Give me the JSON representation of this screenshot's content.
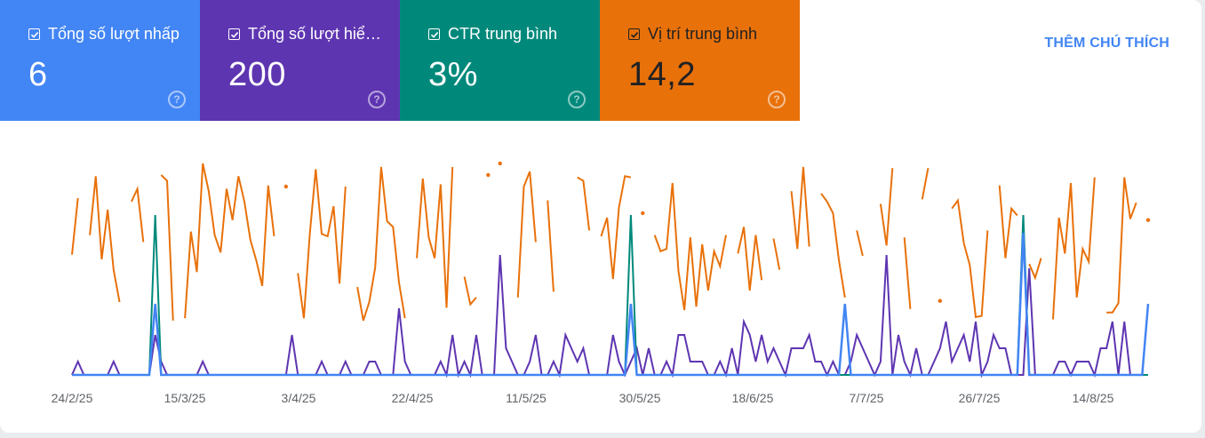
{
  "metrics": [
    {
      "label": "Tổng số lượt nhấp",
      "value": "6",
      "color": "#4285f4",
      "text_color": "#ffffff"
    },
    {
      "label": "Tổng số lượt hiể…",
      "value": "200",
      "color": "#5e35b1",
      "text_color": "#ffffff"
    },
    {
      "label": "CTR trung bình",
      "value": "3%",
      "color": "#00897b",
      "text_color": "#ffffff"
    },
    {
      "label": "Vị trí trung bình",
      "value": "14,2",
      "color": "#e8710a",
      "text_color": "#202124"
    }
  ],
  "annotation_button": "THÊM CHÚ THÍCH",
  "help_glyph": "?",
  "chart_data": {
    "type": "line",
    "x_ticks": [
      "24/2/25",
      "15/3/25",
      "3/4/25",
      "22/4/25",
      "11/5/25",
      "30/5/25",
      "18/6/25",
      "7/7/25",
      "26/7/25",
      "14/8/25"
    ],
    "days": 182,
    "start_date": "2025-02-21",
    "grid": false,
    "series": [
      {
        "color": "#5e35b1",
        "values": [
          0,
          1,
          0,
          0,
          0,
          0,
          0,
          1,
          0,
          0,
          0,
          0,
          0,
          0,
          3,
          1,
          0,
          0,
          0,
          0,
          0,
          0,
          1,
          0,
          0,
          0,
          0,
          0,
          0,
          0,
          0,
          0,
          0,
          0,
          0,
          0,
          0,
          3,
          0,
          0,
          0,
          0,
          1,
          0,
          0,
          0,
          1,
          0,
          0,
          0,
          1,
          1,
          0,
          0,
          0,
          5,
          1,
          0,
          0,
          0,
          0,
          0,
          1,
          0,
          3,
          0,
          1,
          0,
          3,
          0,
          0,
          0,
          9,
          2,
          1,
          0,
          0,
          1,
          3,
          0,
          0,
          1,
          0,
          3,
          2,
          1,
          2,
          0,
          0,
          0,
          0,
          3,
          1,
          0,
          1,
          2,
          0,
          2,
          0,
          0,
          1,
          0,
          3,
          3,
          1,
          1,
          1,
          0,
          0,
          1,
          0,
          2,
          0,
          4,
          3,
          1,
          3,
          1,
          2,
          1,
          0,
          2,
          2,
          2,
          3,
          1,
          1,
          0,
          1,
          0,
          0,
          1,
          3,
          2,
          1,
          0,
          1,
          9,
          0,
          3,
          1,
          0,
          2,
          0,
          0,
          1,
          2,
          4,
          1,
          2,
          3,
          1,
          4,
          0,
          1,
          3,
          2,
          2,
          0,
          0,
          0,
          8,
          0,
          0,
          0,
          0,
          1,
          1,
          0,
          1,
          1,
          1,
          0,
          2,
          2,
          4,
          0,
          4,
          0,
          0,
          0,
          0,
          0,
          0,
          1,
          1,
          1,
          1
        ]
      },
      {
        "color": "#00897b",
        "values": [
          0,
          0,
          0,
          0,
          0,
          0,
          0,
          0,
          0,
          0,
          0,
          0,
          0,
          0,
          1,
          0,
          0,
          0,
          0,
          0,
          0,
          0,
          0,
          0,
          0,
          0,
          0,
          0,
          0,
          0,
          0,
          0,
          0,
          0,
          0,
          0,
          0,
          0,
          0,
          0,
          0,
          0,
          0,
          0,
          0,
          0,
          0,
          0,
          0,
          0,
          0,
          0,
          0,
          0,
          0,
          0,
          0,
          0,
          0,
          0,
          0,
          0,
          0,
          0,
          0,
          0,
          0,
          0,
          0,
          0,
          0,
          0,
          0,
          0,
          0,
          0,
          0,
          0,
          0,
          0,
          0,
          0,
          0,
          0,
          0,
          0,
          0,
          0,
          0,
          0,
          0,
          0,
          0,
          0,
          1,
          0,
          0,
          0,
          0,
          0,
          0,
          0,
          0,
          0,
          0,
          0,
          0,
          0,
          0,
          0,
          0,
          0,
          0,
          0,
          0,
          0,
          0,
          0,
          0,
          0,
          0,
          0,
          0,
          0,
          0,
          0,
          0,
          0,
          0,
          0,
          0,
          0,
          0,
          0,
          0,
          0,
          0,
          0,
          0,
          0,
          0,
          0,
          0,
          0,
          0,
          0,
          0,
          0,
          0,
          0,
          0,
          0,
          0,
          0,
          0,
          0,
          0,
          0,
          0,
          0,
          1,
          0,
          0,
          0,
          0,
          0,
          0,
          0,
          0,
          0,
          0,
          0,
          0,
          0,
          0,
          0,
          0,
          0,
          0,
          0,
          0,
          0,
          0,
          0,
          0,
          0,
          0,
          0,
          0,
          0,
          0,
          0
        ]
      },
      {
        "color": "#4285f4",
        "values": [
          0,
          0,
          0,
          0,
          0,
          0,
          0,
          0,
          0,
          0,
          0,
          0,
          0,
          0,
          1,
          0,
          0,
          0,
          0,
          0,
          0,
          0,
          0,
          0,
          0,
          0,
          0,
          0,
          0,
          0,
          0,
          0,
          0,
          0,
          0,
          0,
          0,
          0,
          0,
          0,
          0,
          0,
          0,
          0,
          0,
          0,
          0,
          0,
          0,
          0,
          0,
          0,
          0,
          0,
          0,
          0,
          0,
          0,
          0,
          0,
          0,
          0,
          0,
          0,
          0,
          0,
          0,
          0,
          0,
          0,
          0,
          0,
          0,
          0,
          0,
          0,
          0,
          0,
          0,
          0,
          0,
          0,
          0,
          0,
          0,
          0,
          0,
          0,
          0,
          0,
          0,
          0,
          0,
          0,
          1,
          0,
          0,
          0,
          0,
          0,
          0,
          0,
          0,
          0,
          0,
          0,
          0,
          0,
          0,
          0,
          0,
          0,
          0,
          0,
          0,
          0,
          0,
          0,
          0,
          0,
          0,
          0,
          0,
          0,
          0,
          0,
          0,
          0,
          0,
          0,
          1,
          0,
          0,
          0,
          0,
          0,
          0,
          0,
          0,
          0,
          0,
          0,
          0,
          0,
          0,
          0,
          0,
          0,
          0,
          0,
          0,
          0,
          0,
          0,
          0,
          0,
          0,
          0,
          0,
          0,
          2,
          0,
          0,
          0,
          0,
          0,
          0,
          0,
          0,
          0,
          0,
          0,
          0,
          0,
          0,
          0,
          0,
          0,
          0,
          0,
          0,
          1,
          0,
          0,
          0,
          0,
          0,
          0,
          0,
          0,
          0,
          0
        ]
      },
      {
        "color": "#e8710a",
        "values": [
          null,
          3,
          null,
          null,
          null,
          null,
          null,
          null,
          12,
          null,
          null,
          null,
          null,
          null,
          null,
          1,
          1.5,
          null,
          null,
          null,
          null,
          null,
          0,
          null,
          null,
          null,
          null,
          null,
          null,
          null,
          null,
          null,
          null,
          null,
          null,
          null,
          2,
          null,
          null,
          null,
          null,
          0.5,
          null,
          null,
          null,
          null,
          2,
          null,
          null,
          null,
          null,
          null,
          null,
          null,
          null,
          null,
          null,
          null,
          null,
          null,
          null,
          null,
          null,
          null,
          null,
          null,
          null,
          null,
          null,
          null,
          1,
          null,
          0,
          null,
          null,
          null,
          null,
          null,
          null,
          null,
          null,
          null,
          null,
          null,
          null,
          null,
          null,
          null,
          null,
          null,
          null,
          null,
          null,
          null,
          null,
          null,
          null,
          null,
          null,
          null,
          null,
          null,
          null,
          null,
          null,
          null,
          null,
          null,
          null,
          null,
          null,
          null,
          null,
          null,
          null,
          null,
          null,
          null,
          null,
          null,
          null,
          null,
          null,
          null,
          null,
          null,
          null,
          null,
          null,
          null,
          null,
          null,
          null,
          null,
          null,
          null,
          null,
          null,
          null,
          null,
          null,
          null,
          null,
          null,
          null,
          null,
          null,
          null,
          null,
          null,
          null,
          null,
          null,
          null,
          null,
          null,
          null,
          null,
          null,
          null,
          null,
          null,
          null,
          null,
          null,
          null,
          null,
          null,
          null,
          null,
          null,
          null,
          null,
          null,
          null,
          null,
          null,
          null,
          null,
          null,
          null,
          null,
          null,
          null,
          null,
          null
        ]
      }
    ]
  }
}
